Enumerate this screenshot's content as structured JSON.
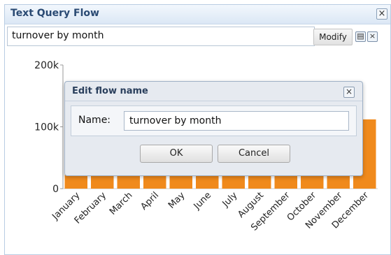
{
  "panel": {
    "title": "Text Query Flow",
    "close_glyph": "×"
  },
  "query": {
    "value": "turnover by month",
    "modify_label": "Modify",
    "save_icon": "save-icon",
    "remove_icon": "close-icon",
    "remove_glyph": "×",
    "save_glyph": "▤"
  },
  "dialog": {
    "title": "Edit flow name",
    "close_glyph": "×",
    "name_label": "Name:",
    "name_value": "turnover by month",
    "ok_label": "OK",
    "cancel_label": "Cancel"
  },
  "colors": {
    "bar": "#f08a1c",
    "bar_faded": "#f5ddc8"
  },
  "chart_data": {
    "type": "bar",
    "categories": [
      "January",
      "February",
      "March",
      "April",
      "May",
      "June",
      "July",
      "August",
      "September",
      "October",
      "November",
      "December"
    ],
    "values": [
      112000,
      112000,
      112000,
      112000,
      112000,
      112000,
      112000,
      112000,
      112000,
      112000,
      112000,
      112000
    ],
    "ylim": [
      0,
      200000
    ],
    "yticks": [
      {
        "value": 0,
        "label": "0"
      },
      {
        "value": 100000,
        "label": "100k"
      },
      {
        "value": 200000,
        "label": "200k"
      }
    ],
    "grid": false
  }
}
